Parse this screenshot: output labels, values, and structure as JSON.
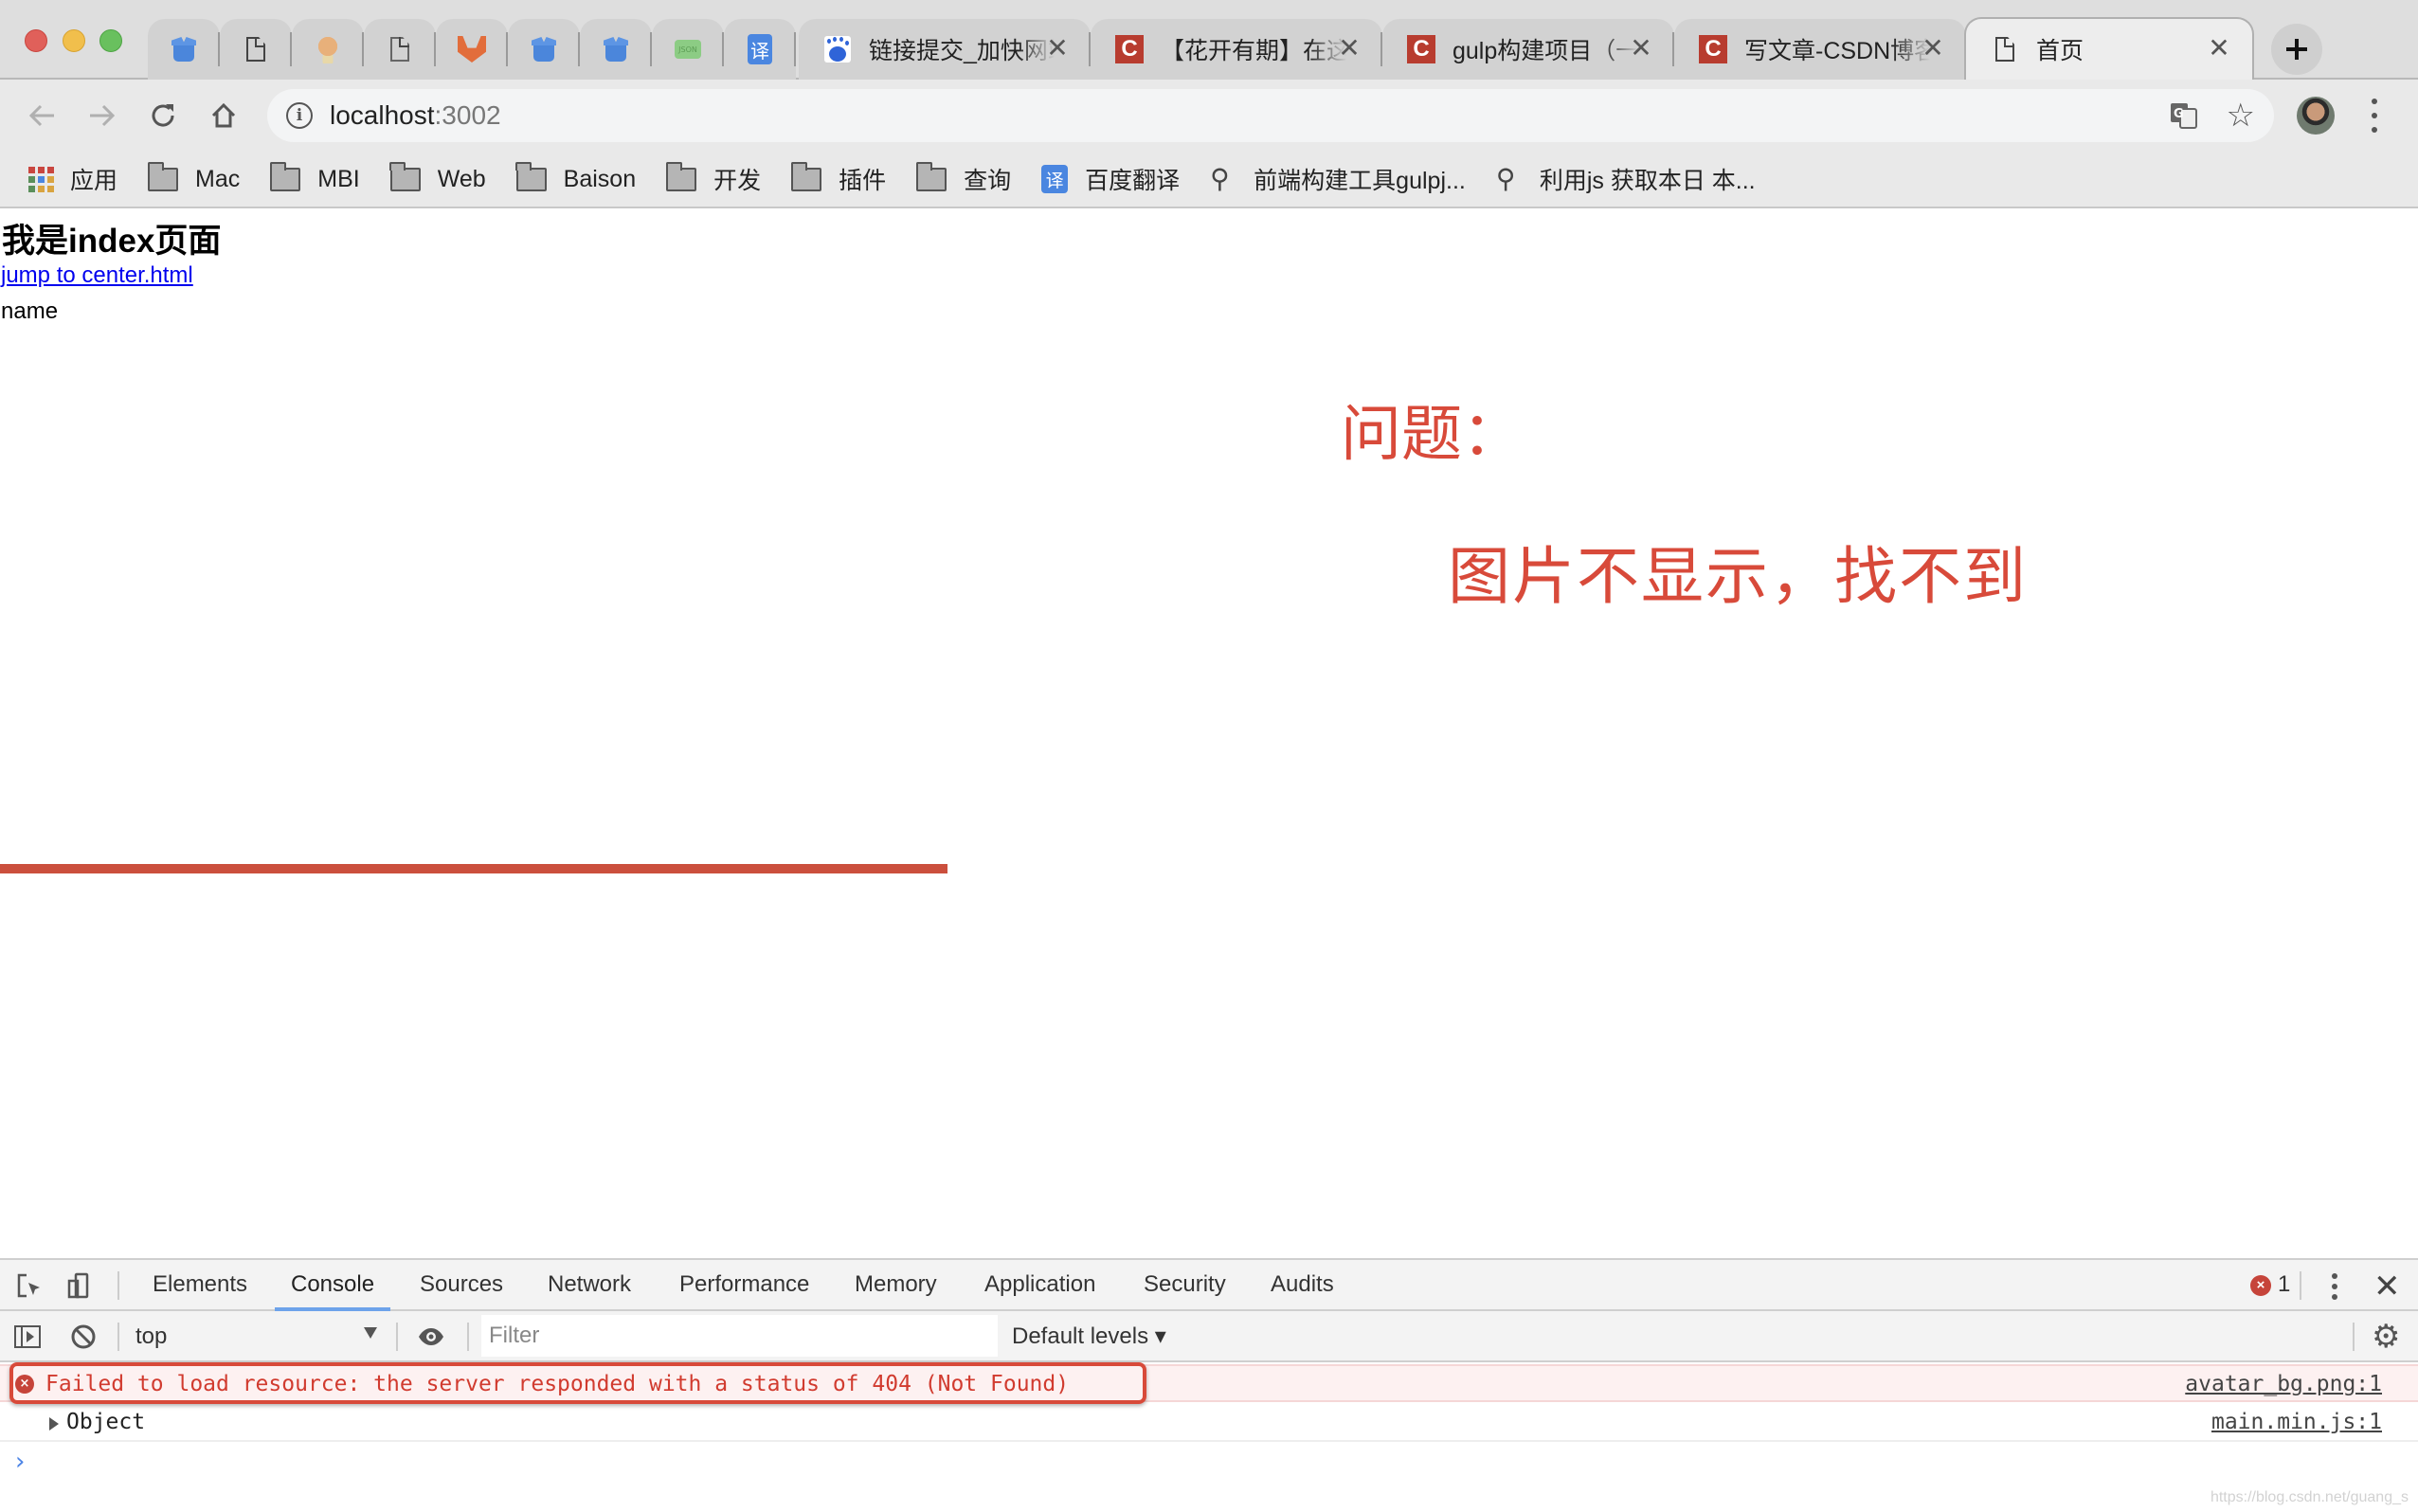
{
  "window": {
    "controls": [
      "close",
      "minimize",
      "maximize"
    ]
  },
  "tabs": {
    "pinned": [
      {
        "icon": "box-icon"
      },
      {
        "icon": "document-icon"
      },
      {
        "icon": "monkey-icon"
      },
      {
        "icon": "document-icon"
      },
      {
        "icon": "gitlab-icon"
      },
      {
        "icon": "box-icon"
      },
      {
        "icon": "box-icon"
      },
      {
        "icon": "json-icon",
        "icon_text": "JSON"
      },
      {
        "icon": "translate-icon",
        "icon_text": "译"
      }
    ],
    "wide": [
      {
        "icon": "baidu-icon",
        "title": "链接提交_加快网站收录",
        "active": false
      },
      {
        "icon": "csdn-icon",
        "icon_text": "C",
        "title": "【花开有期】在这里",
        "active": false
      },
      {
        "icon": "csdn-icon",
        "icon_text": "C",
        "title": "gulp构建项目（一）",
        "active": false
      },
      {
        "icon": "csdn-icon",
        "icon_text": "C",
        "title": "写文章-CSDN博客",
        "active": false
      },
      {
        "icon": "document-icon",
        "title": "首页",
        "active": true
      }
    ],
    "close_glyph": "✕",
    "new_tab_glyph": "+"
  },
  "toolbar": {
    "back_glyph": "←",
    "forward_glyph": "→",
    "reload_glyph": "↻",
    "home_glyph": "⌂",
    "url_host": "localhost",
    "url_port": ":3002",
    "info_glyph": "i",
    "star_glyph": "☆"
  },
  "bookmarks": [
    {
      "icon": "apps-icon",
      "label": "应用"
    },
    {
      "icon": "folder-icon",
      "label": "Mac"
    },
    {
      "icon": "folder-icon",
      "label": "MBI"
    },
    {
      "icon": "folder-icon",
      "label": "Web"
    },
    {
      "icon": "folder-icon",
      "label": "Baison"
    },
    {
      "icon": "folder-icon",
      "label": "开发"
    },
    {
      "icon": "folder-icon",
      "label": "插件"
    },
    {
      "icon": "folder-icon",
      "label": "查询"
    },
    {
      "icon": "translate-icon",
      "icon_text": "译",
      "label": "百度翻译"
    },
    {
      "icon": "search-doc-icon",
      "label": "前端构建工具gulpj..."
    },
    {
      "icon": "search-doc-icon",
      "label": "利用js 获取本日 本..."
    }
  ],
  "apps_colors": [
    "#c9463f",
    "#c9463f",
    "#c9463f",
    "#5b8f5b",
    "#4a86e0",
    "#d9a441",
    "#5b8f5b",
    "#d9a441",
    "#d9a441"
  ],
  "page": {
    "heading": "我是index页面",
    "link": "jump to center.html",
    "name_text": "name"
  },
  "annotation": {
    "line1": "问题：",
    "line2": "图片不显示，找不到",
    "color": "#d84a3a"
  },
  "devtools": {
    "tabs": [
      "Elements",
      "Console",
      "Sources",
      "Network",
      "Performance",
      "Memory",
      "Application",
      "Security",
      "Audits"
    ],
    "active_tab": "Console",
    "error_count": "1",
    "context": "top",
    "filter_placeholder": "Filter",
    "levels": "Default levels ▾",
    "messages": [
      {
        "level": "error",
        "text": "Failed to load resource: the server responded with a status of 404 (Not Found)",
        "source": "avatar_bg.png:1"
      },
      {
        "level": "log",
        "text": "Object",
        "source": "main.min.js:1"
      }
    ],
    "prompt_glyph": "›"
  },
  "watermark": "https://blog.csdn.net/guang_s"
}
